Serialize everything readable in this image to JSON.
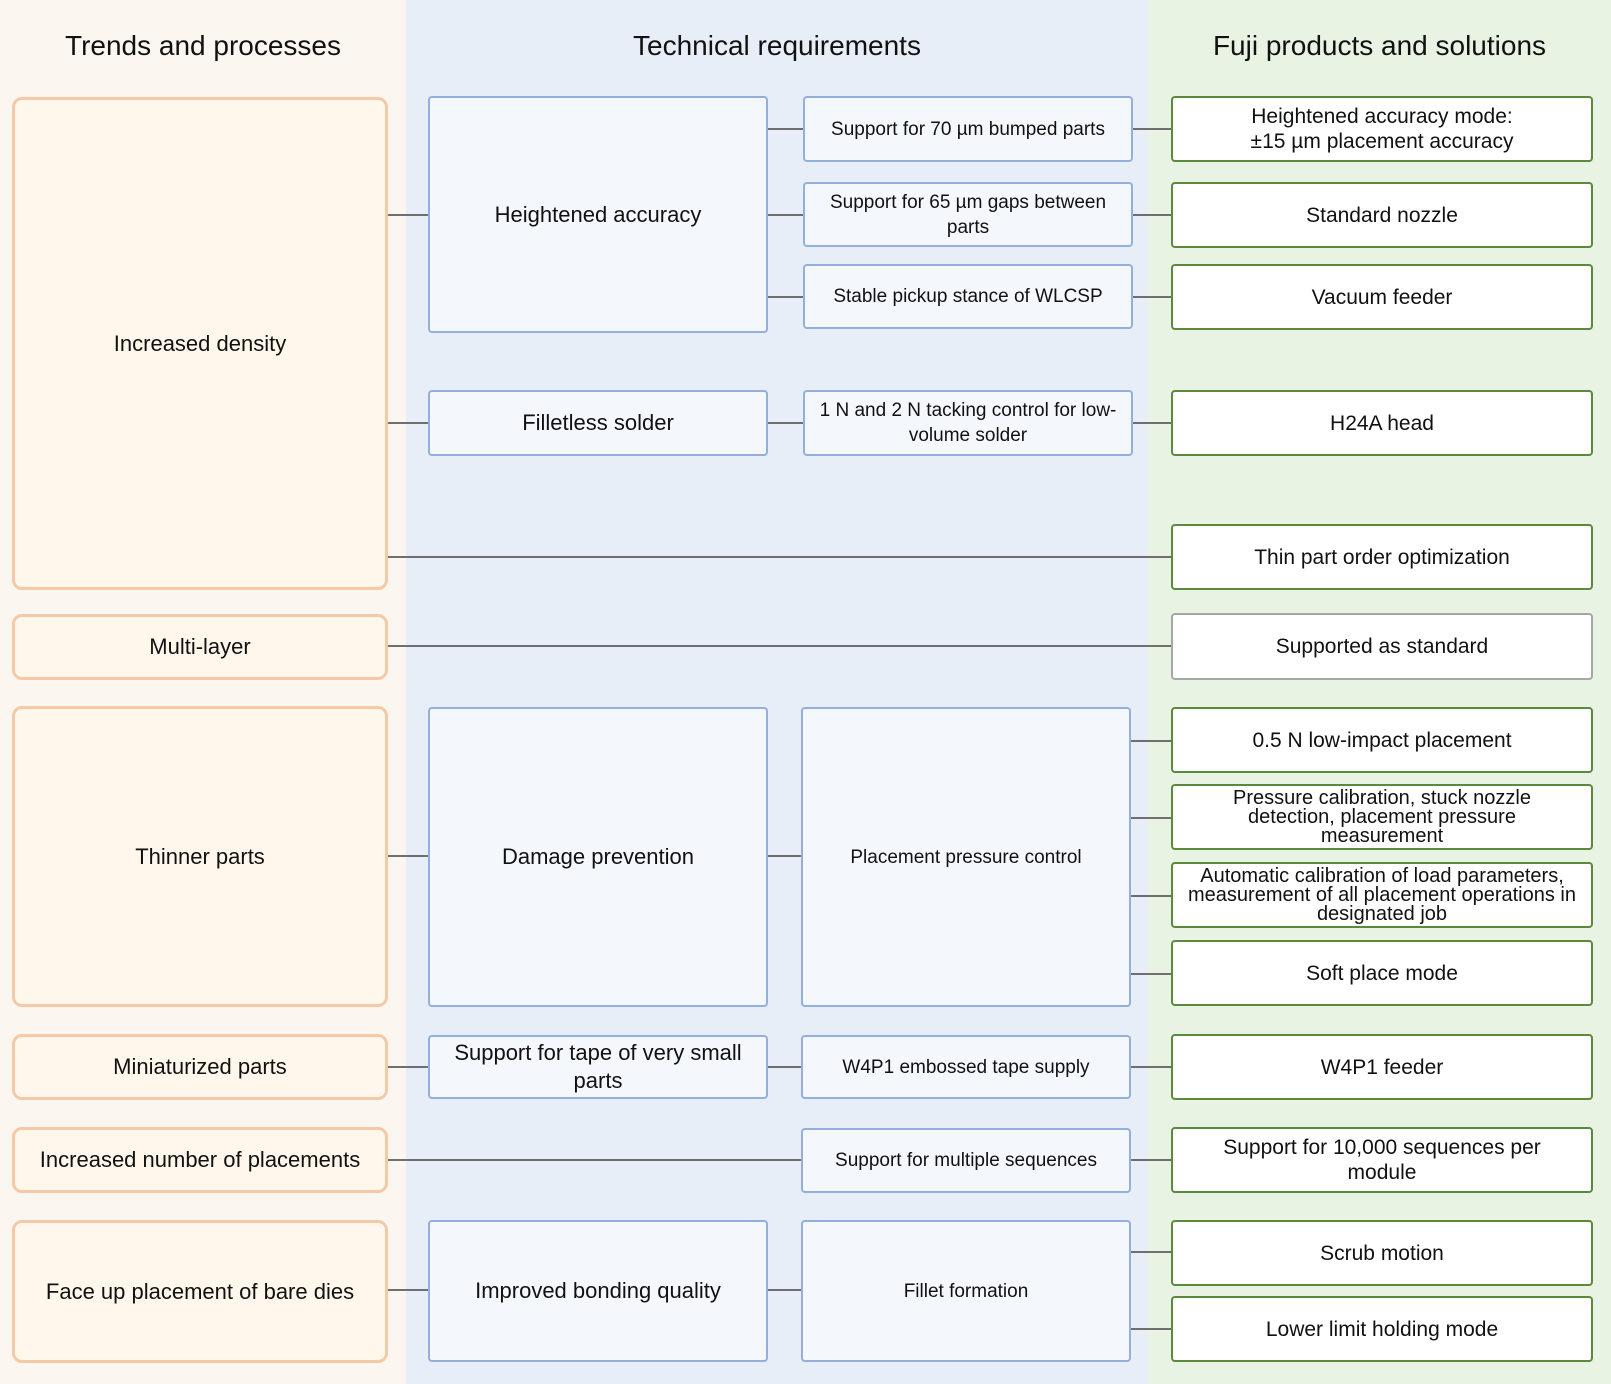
{
  "lanes": {
    "trends_title": "Trends and processes",
    "requirements_title": "Technical requirements",
    "products_title": "Fuji products and solutions"
  },
  "colors": {
    "trends_lane": "#fcf6f1",
    "trends_box_fill": "#fff7ec",
    "trends_box_border": "#f6c9a6",
    "requirements_lane": "#e8eef8",
    "requirements_box_border": "#93b0dd",
    "products_lane": "#e9f3e4",
    "products_box_border": "#5a8a3a",
    "neutral_box_border": "#a6a6a6",
    "connector": "#6f6f6f"
  },
  "trends": [
    "Increased density",
    "Multi-layer",
    "Thinner parts",
    "Miniaturized parts",
    "Increased number of placements",
    "Face up placement of bare dies"
  ],
  "requirements_primary": [
    "Heightened accuracy",
    "Filletless solder",
    "Damage prevention",
    "Support for tape of very small parts",
    "Improved bonding quality"
  ],
  "requirements_secondary": [
    "Support for 70 µm bumped parts",
    "Support for 65 µm gaps between parts",
    "Stable pickup stance of WLCSP",
    "1 N and 2 N tacking control for low-volume solder",
    "Placement pressure control",
    "W4P1 embossed tape supply",
    "Support for multiple sequences",
    "Fillet formation"
  ],
  "products": [
    "Heightened accuracy mode: ±15 µm placement accuracy",
    "Standard nozzle",
    "Vacuum feeder",
    "H24A head",
    "Thin part order optimization",
    "Supported as standard",
    "0.5 N low-impact placement",
    "Pressure calibration, stuck nozzle detection, placement pressure measurement",
    "Automatic calibration of load parameters, measurement of all placement operations in designated job",
    "Soft place mode",
    "W4P1 feeder",
    "Support for 10,000 sequences per module",
    "Scrub motion",
    "Lower limit holding mode"
  ]
}
